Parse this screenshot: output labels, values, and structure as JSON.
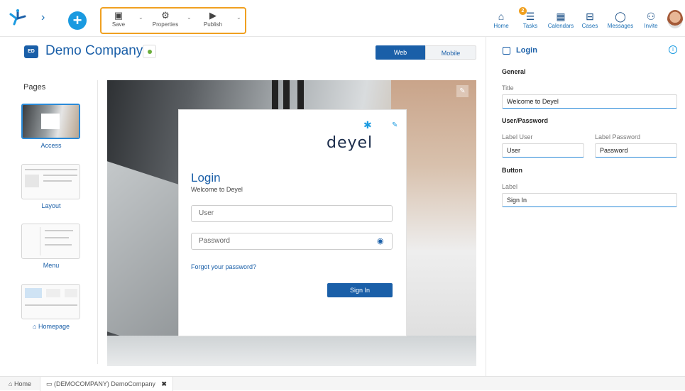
{
  "toolbar": {
    "save_label": "Save",
    "properties_label": "Properties",
    "publish_label": "Publish"
  },
  "nav": {
    "home": "Home",
    "tasks": "Tasks",
    "tasks_badge": "2",
    "calendars": "Calendars",
    "cases": "Cases",
    "messages": "Messages",
    "invite": "Invite"
  },
  "header": {
    "badge": "ED",
    "company": "Demo Company",
    "view_web": "Web",
    "view_mobile": "Mobile"
  },
  "pages": {
    "title": "Pages",
    "items": [
      {
        "label": "Access"
      },
      {
        "label": "Layout"
      },
      {
        "label": "Menu"
      },
      {
        "label": "Homepage"
      }
    ]
  },
  "login_card": {
    "brand": "deyel",
    "title": "Login",
    "subtitle": "Welcome to Deyel",
    "user_placeholder": "User",
    "password_placeholder": "Password",
    "forgot": "Forgot your password?",
    "sign_in": "Sign In"
  },
  "properties": {
    "title": "Login",
    "general_section": "General",
    "title_label": "Title",
    "title_value": "Welcome to Deyel",
    "user_password_section": "User/Password",
    "label_user_label": "Label User",
    "label_user_value": "User",
    "label_password_label": "Label Password",
    "label_password_value": "Password",
    "button_section": "Button",
    "button_label_label": "Label",
    "button_label_value": "Sign In"
  },
  "bottom": {
    "home": "Home",
    "tab": "(DEMOCOMPANY) DemoCompany"
  },
  "colors": {
    "primary": "#1a5fa8",
    "accent": "#1a9ae0",
    "highlight": "#f0a020",
    "status": "#6cae3c"
  }
}
